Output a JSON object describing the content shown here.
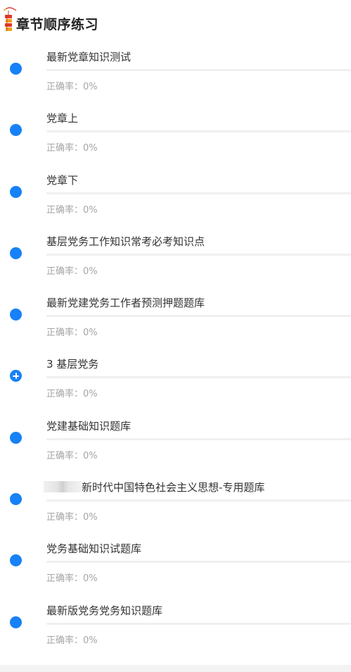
{
  "header": {
    "title": "章节顺序练习",
    "icon": "firecracker-icon"
  },
  "accuracy_label": "正确率：",
  "chapters": [
    {
      "name": "最新党章知识测试",
      "accuracy": "0%",
      "progress": 0,
      "indicator": "dot"
    },
    {
      "name": "党章上",
      "accuracy": "0%",
      "progress": 0,
      "indicator": "dot"
    },
    {
      "name": "党章下",
      "accuracy": "0%",
      "progress": 0,
      "indicator": "dot"
    },
    {
      "name": "基层党务工作知识常考必考知识点",
      "accuracy": "0%",
      "progress": 0,
      "indicator": "dot"
    },
    {
      "name": "最新党建党务工作者预测押题题库",
      "accuracy": "0%",
      "progress": 0,
      "indicator": "dot"
    },
    {
      "name": "3 基层党务",
      "accuracy": "0%",
      "progress": 0,
      "indicator": "plus"
    },
    {
      "name": "党建基础知识题库",
      "accuracy": "0%",
      "progress": 0,
      "indicator": "dot"
    },
    {
      "name": "新时代中国特色社会主义思想-专用题库",
      "accuracy": "0%",
      "progress": 0,
      "indicator": "dot",
      "redacted_prefix": true
    },
    {
      "name": "党务基础知识试题库",
      "accuracy": "0%",
      "progress": 0,
      "indicator": "dot"
    },
    {
      "name": "最新版党务党务知识题库",
      "accuracy": "0%",
      "progress": 0,
      "indicator": "dot"
    }
  ],
  "colors": {
    "accent": "#1781f7",
    "title": "#222222",
    "text": "#333333",
    "muted": "#a5a5a5",
    "track": "#f0f0f0"
  }
}
